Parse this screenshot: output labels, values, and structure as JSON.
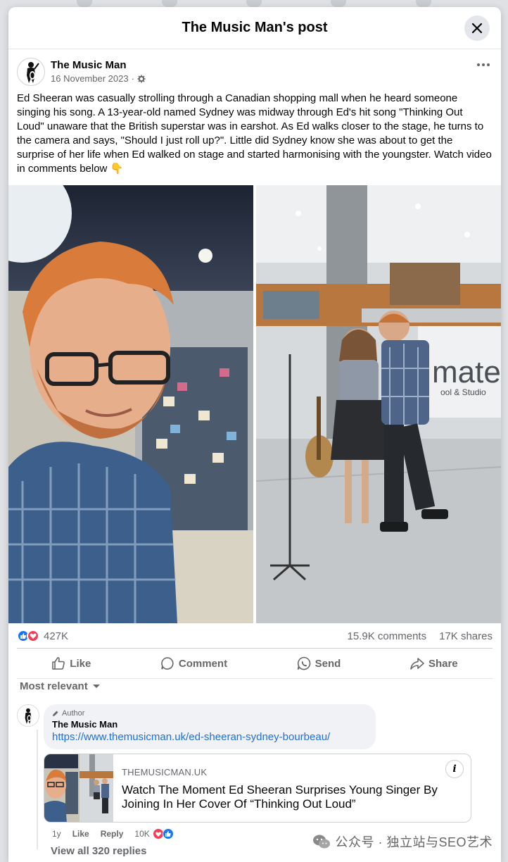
{
  "modal": {
    "title": "The Music Man's post"
  },
  "post": {
    "page_name": "The Music Man",
    "date": "16 November 2023",
    "dot": "·",
    "text": "Ed Sheeran was casually strolling through a Canadian shopping mall when he heard someone singing his song. A 13-year-old named Sydney was midway through Ed's hit song \"Thinking Out Loud\" unaware that the British superstar was in earshot. As Ed walks closer to the stage, he turns to the camera and says, \"Should I just roll up?\". Little did Sydney know she was about to get the surprise of her life when Ed walked on stage and started harmonising with the youngster. Watch video in comments below 👇",
    "photo_sign": "mate",
    "photo_sign_sub": "ool & Studio"
  },
  "stats": {
    "reactions": "427K",
    "comments": "15.9K comments",
    "shares": "17K shares"
  },
  "actions": {
    "like": "Like",
    "comment": "Comment",
    "send": "Send",
    "share": "Share"
  },
  "sort": {
    "label": "Most relevant"
  },
  "comment": {
    "badge": "Author",
    "name": "The Music Man",
    "link": "https://www.themusicman.uk/ed-sheeran-sydney-bourbeau/",
    "card_domain": "THEMUSICMAN.UK",
    "card_title": "Watch The Moment Ed Sheeran Surprises Young Singer By Joining In Her Cover Of “Thinking Out Loud”",
    "age": "1y",
    "like": "Like",
    "reply": "Reply",
    "reaction_count": "10K",
    "view_replies": "View all 320 replies"
  },
  "watermark": {
    "text": "公众号 · 独立站与SEO艺术"
  },
  "colors": {
    "like_blue": "#1877f2",
    "love_red": "#f33e58",
    "link_blue": "#216fdb",
    "secondary_text": "#65676b"
  },
  "icons": [
    "close-icon",
    "gear-icon",
    "more-icon",
    "like-icon",
    "comment-icon",
    "send-icon",
    "share-icon",
    "chevron-down-icon",
    "pencil-icon",
    "info-icon",
    "wechat-icon"
  ]
}
